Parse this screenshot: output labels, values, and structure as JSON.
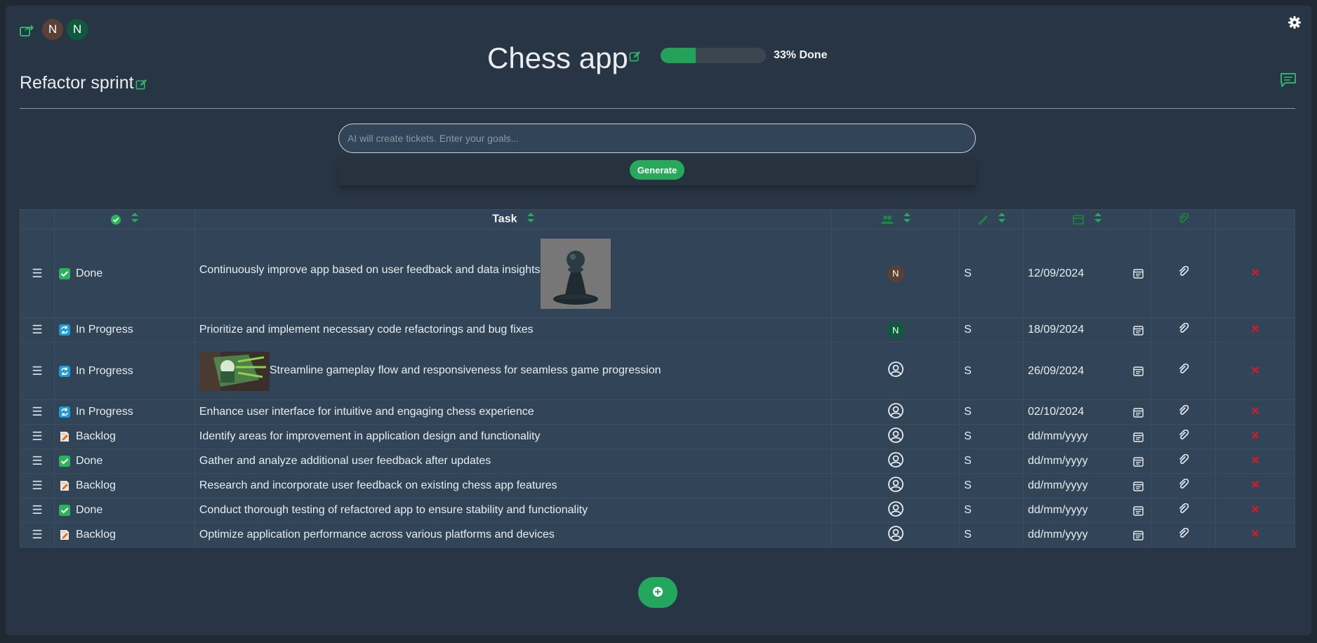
{
  "header": {
    "avatars": [
      {
        "initial": "N",
        "color": "#5b4036"
      },
      {
        "initial": "N",
        "color": "#0f5a3c"
      }
    ],
    "project_title": "Chess app",
    "progress_percent": 33,
    "progress_label": "33% Done",
    "sprint_title": "Refactor sprint"
  },
  "ai": {
    "placeholder": "AI will create tickets. Enter your goals...",
    "generate_label": "Generate"
  },
  "table": {
    "task_header": "Task",
    "rows": [
      {
        "status": "Done",
        "status_icon": "check-icon",
        "task": "Continuously improve app based on user feedback and data insights",
        "image": "pawn-image",
        "assignee": "N",
        "assignee_color": "#5b4036",
        "size": "S",
        "date": "12/09/2024"
      },
      {
        "status": "In Progress",
        "status_icon": "sync-icon",
        "task": "Prioritize and implement necessary code refactorings and bug fixes",
        "assignee": "N",
        "assignee_color": "#0f5a3c",
        "size": "S",
        "date": "18/09/2024"
      },
      {
        "status": "In Progress",
        "status_icon": "sync-icon",
        "task": "Streamline gameplay flow and responsiveness for seamless game progression",
        "image": "gameplay-image",
        "assignee": "",
        "size": "S",
        "date": "26/09/2024"
      },
      {
        "status": "In Progress",
        "status_icon": "sync-icon",
        "task": "Enhance user interface for intuitive and engaging chess experience",
        "assignee": "",
        "size": "S",
        "date": "02/10/2024"
      },
      {
        "status": "Backlog",
        "status_icon": "memo-icon",
        "task": "Identify areas for improvement in application design and functionality",
        "assignee": "",
        "size": "S",
        "date": "dd/mm/yyyy"
      },
      {
        "status": "Done",
        "status_icon": "check-icon",
        "task": "Gather and analyze additional user feedback after updates",
        "assignee": "",
        "size": "S",
        "date": "dd/mm/yyyy"
      },
      {
        "status": "Backlog",
        "status_icon": "memo-icon",
        "task": "Research and incorporate user feedback on existing chess app features",
        "assignee": "",
        "size": "S",
        "date": "dd/mm/yyyy"
      },
      {
        "status": "Done",
        "status_icon": "check-icon",
        "task": "Conduct thorough testing of refactored app to ensure stability and functionality",
        "assignee": "",
        "size": "S",
        "date": "dd/mm/yyyy"
      },
      {
        "status": "Backlog",
        "status_icon": "memo-icon",
        "task": "Optimize application performance across various platforms and devices",
        "assignee": "",
        "size": "S",
        "date": "dd/mm/yyyy"
      }
    ]
  },
  "colors": {
    "accent": "#27a85a",
    "background": "#283544",
    "row": "#324457",
    "delete": "#d11a2a",
    "in_progress": "#1e9ad6",
    "done": "#2bb55a"
  }
}
